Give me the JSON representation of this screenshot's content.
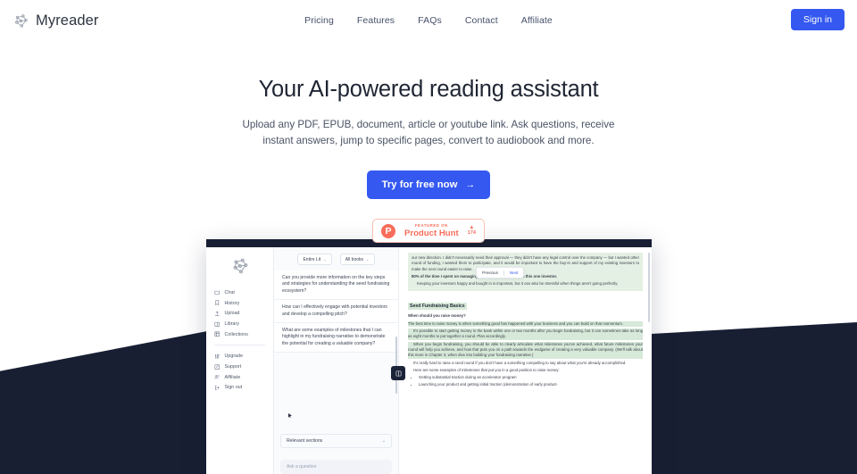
{
  "brand": {
    "name": "Myreader",
    "logo_icon": "brain-network-icon"
  },
  "nav": {
    "items": [
      {
        "label": "Pricing"
      },
      {
        "label": "Features"
      },
      {
        "label": "FAQs"
      },
      {
        "label": "Contact"
      },
      {
        "label": "Affiliate"
      }
    ],
    "signin_label": "Sign in",
    "signin_color": "#3458f0"
  },
  "hero": {
    "title": "Your AI-powered reading assistant",
    "subtitle": "Upload any PDF, EPUB, document, article or youtube link. Ask questions, receive instant answers, jump to specific pages, convert to audiobook and more.",
    "cta_label": "Try for free now",
    "cta_arrow": "→",
    "cta_color": "#3458f0"
  },
  "product_hunt": {
    "featured_on": "FEATURED ON",
    "name": "Product Hunt",
    "logo_letter": "P",
    "caret": "▲",
    "votes": "174",
    "color": "#f96d5b"
  },
  "app": {
    "sidebar": {
      "logo_icon": "brain-network-icon",
      "primary_items": [
        {
          "label": "Chat",
          "icon": "chat-icon"
        },
        {
          "label": "History",
          "icon": "bookmark-icon"
        },
        {
          "label": "Upload",
          "icon": "upload-icon"
        },
        {
          "label": "Library",
          "icon": "book-icon"
        },
        {
          "label": "Collections",
          "icon": "grid-icon"
        }
      ],
      "secondary_items": [
        {
          "label": "Upgrade",
          "icon": "sliders-icon"
        },
        {
          "label": "Support",
          "icon": "edit-square-icon"
        },
        {
          "label": "Affiliate",
          "icon": "users-icon"
        },
        {
          "label": "Sign out",
          "icon": "logout-icon"
        }
      ]
    },
    "chat": {
      "filters": [
        {
          "label": "Entire Lit",
          "caret": "⌄"
        },
        {
          "label": "All books",
          "caret": "⌄"
        }
      ],
      "questions": [
        {
          "text": "Can you provide more information on the key steps and strategies for understanding the seed fundraising ecosystem?"
        },
        {
          "text": "How can I effectively engage with potential investors and develop a compelling pitch?"
        },
        {
          "text": "What are some examples of milestones that I can highlight in my fundraising narrative to demonstrate the potential for creating a valuable company?"
        }
      ],
      "relevant_sections_label": "Relevant sections",
      "relevant_sections_caret": "⌄",
      "input_placeholder": "Ask a question",
      "expand_icon": "expand-panel-icon"
    },
    "viewer": {
      "nav": {
        "previous_label": "Previous",
        "next_label": "Next"
      },
      "paragraphs": [
        "our new direction. I didn't necessarily need their approval — they didn't have any legal control over the company — but I wanted                                other round of funding, I wanted them to participate, and it would be important to have the buy-in and support of my existing investors to make the next round easier to raise.",
        "80% of the time I spent on managing investors was spent with this one investor.",
        "Keeping your investors happy and bought in is important, but it can also be stressful when things aren't going perfectly."
      ],
      "heading": "Seed Fundraising Basics",
      "subheading": "When should you raise money?",
      "body": [
        "The best time to raise money is when something good has happened with your business and you can build on that momentum.",
        "It's possible to start getting money in the bank within one or two months after you begin fundraising, but it can sometimes take as long as eight months to put together a round. Plan accordingly.",
        "When you begin fundraising, you should be able to clearly articulate what milestones you've achieved, what future milestones your round will help you achieve, and how that puts you on a path towards the endgame of creating a very valuable company. (We'll talk about this more in Chapter 3, when dive into building your fundraising narrative.)",
        "It's really hard to raise a seed round if you don't have a something compelling to say about what you're already accomplished.",
        "Here are some examples of milestones that put you in a good position to raise money:"
      ],
      "bullets": [
        "Getting substantial traction during an accelerator program",
        "Launching your product and getting initial traction (demonstration of early product-"
      ]
    }
  },
  "colors": {
    "dark_wedge": "#181f33",
    "accent": "#3458f0"
  }
}
